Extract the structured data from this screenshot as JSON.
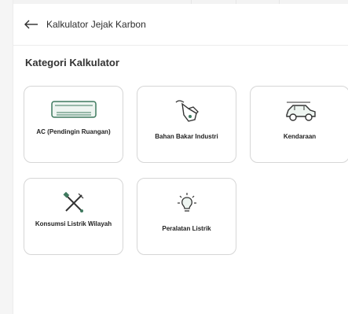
{
  "header": {
    "back_icon": "arrow-left-icon",
    "title": "Kalkulator Jejak Karbon"
  },
  "section": {
    "title": "Kategori Kalkulator"
  },
  "accent_color": "#3f7a5f",
  "categories": [
    {
      "label": "AC (Pendingin Ruangan)",
      "icon": "air-conditioner-icon"
    },
    {
      "label": "Bahan Bakar Industri",
      "icon": "fuel-nozzle-icon"
    },
    {
      "label": "Kendaraan",
      "icon": "car-icon"
    },
    {
      "label": "Konsumsi Listrik Wilayah",
      "icon": "tools-icon"
    },
    {
      "label": "Peralatan Listrik",
      "icon": "light-bulb-icon"
    }
  ]
}
